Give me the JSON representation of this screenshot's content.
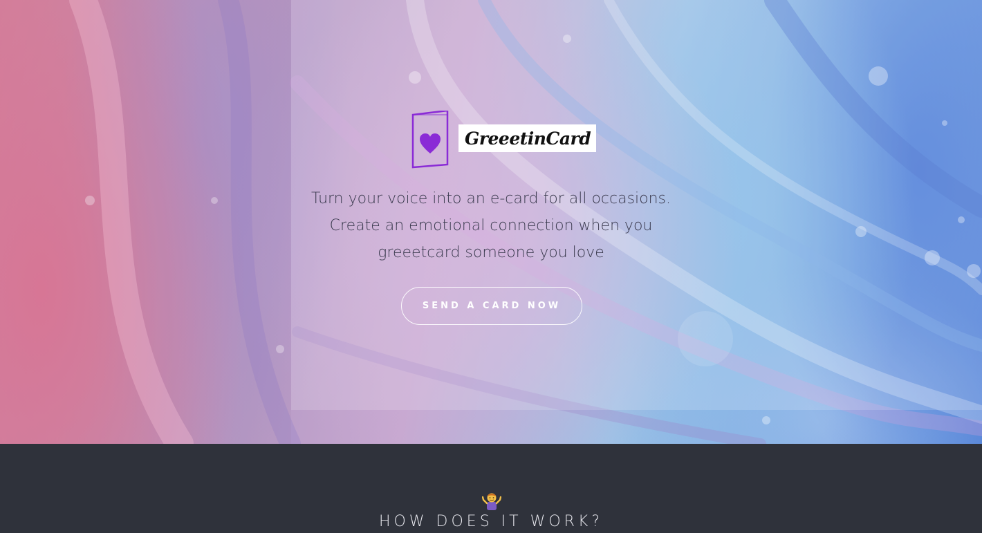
{
  "brand": {
    "logo_text": "GreeetinCard",
    "icon": "greeting-card-heart-icon",
    "accent_color": "#8a2bd6"
  },
  "hero": {
    "tagline_lines": [
      "Turn your voice into an e-card for all occasions.",
      "Create an emotional connection when you",
      "greeetcard someone you love"
    ],
    "cta_label": "SEND A CARD NOW"
  },
  "how_section": {
    "icon": "person-shrugging-icon",
    "title": "HOW DOES IT WORK?",
    "background_color": "#2f323b"
  }
}
